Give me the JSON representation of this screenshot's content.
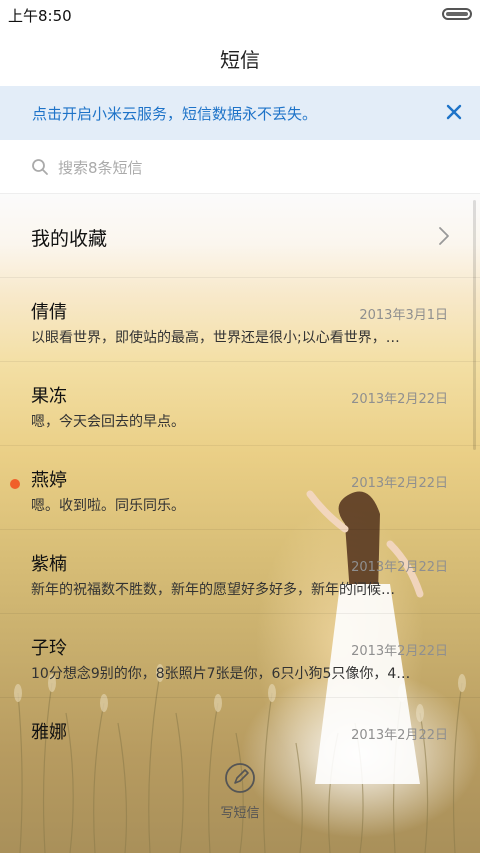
{
  "status_bar": {
    "time": "上午8:50"
  },
  "header": {
    "title": "短信"
  },
  "banner": {
    "text": "点击开启小米云服务，短信数据永不丢失。",
    "close_icon": "close-icon",
    "accent": "#1e73c8"
  },
  "search": {
    "placeholder": "搜索8条短信",
    "icon": "search-icon"
  },
  "favorites": {
    "label": "我的收藏"
  },
  "conversations": [
    {
      "name": "倩倩",
      "date": "2013年3月1日",
      "snippet": "以眼看世界，即使站的最高，世界还是很小;以心看世界，…",
      "unread": false
    },
    {
      "name": "果冻",
      "date": "2013年2月22日",
      "snippet": "嗯，今天会回去的早点。",
      "unread": false
    },
    {
      "name": "燕婷",
      "date": "2013年2月22日",
      "snippet": "嗯。收到啦。同乐同乐。",
      "unread": true
    },
    {
      "name": "紫楠",
      "date": "2013年2月22日",
      "snippet": "新年的祝福数不胜数，新年的愿望好多好多，新年的问候…",
      "unread": false
    },
    {
      "name": "子玲",
      "date": "2013年2月22日",
      "snippet": "10分想念9别的你，8张照片7张是你，6只小狗5只像你，4…",
      "unread": false
    },
    {
      "name": "雅娜",
      "date": "2013年2月22日",
      "snippet": "",
      "unread": false
    }
  ],
  "compose": {
    "label": "写短信",
    "icon": "compose-icon"
  },
  "colors": {
    "unread_dot": "#f0602a",
    "date_text": "#8f8f8f"
  }
}
